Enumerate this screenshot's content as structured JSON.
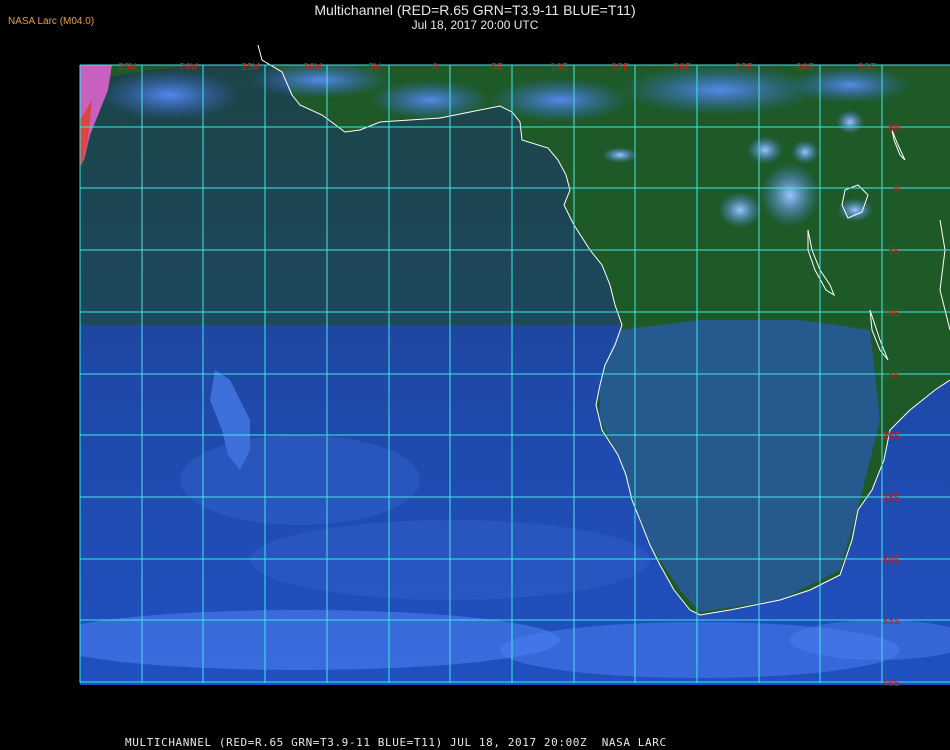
{
  "header": {
    "tag": "NASA Larc (M04.0)",
    "title": "Multichannel (RED=R.65 GRN=T3.9-11 BLUE=T11)",
    "subtitle": "Jul 18, 2017 20:00 UTC"
  },
  "footer": "MULTICHANNEL (RED=R.65 GRN=T3.9-11 BLUE=T11) JUL 18, 2017 20:00Z  NASA LARC",
  "grid": {
    "longitudes": [
      "25W",
      "20W",
      "15W",
      "10W",
      "5W",
      "0",
      "5E",
      "10E",
      "15E",
      "20E",
      "25E",
      "30E",
      "35E"
    ],
    "latitudes": [
      "5N",
      "0",
      "5S",
      "10S",
      "15S",
      "20S",
      "25S",
      "30S",
      "35S",
      "40S"
    ]
  },
  "colors": {
    "grid": "#40e8e8",
    "coast": "#ffffff",
    "label": "#d01818",
    "ocean": "#1e4aa8",
    "land": "#1e5a2a",
    "cloud": "#4a7ee8"
  }
}
